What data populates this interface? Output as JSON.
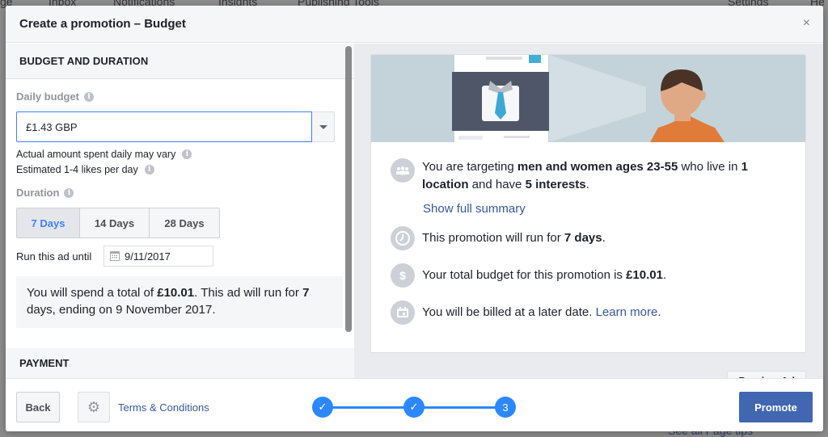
{
  "background": {
    "nav_items": [
      "ge",
      "Inbox",
      "Notifications",
      "Insights",
      "Publishing Tools",
      "Settings",
      "He"
    ],
    "bottom_tips": "See all Page tips"
  },
  "modal": {
    "title": "Create a promotion – Budget",
    "close_icon": "×"
  },
  "left": {
    "section_header": "BUDGET AND DURATION",
    "daily_budget_label": "Daily budget",
    "daily_budget_value": "£1.43 GBP",
    "hint_spend": "Actual amount spent daily may vary",
    "hint_likes": "Estimated 1-4 likes per day",
    "duration_label": "Duration",
    "duration_options": [
      {
        "label": "7 Days",
        "selected": true
      },
      {
        "label": "14 Days",
        "selected": false
      },
      {
        "label": "28 Days",
        "selected": false
      }
    ],
    "run_until_label": "Run this ad until",
    "run_until_date": "9/11/2017",
    "summary": {
      "pre": "You will spend a total of ",
      "total": "£10.01",
      "mid": ". This ad will run for ",
      "days": "7",
      "post": " days, ending on 9 November 2017."
    },
    "payment_header": "PAYMENT"
  },
  "right": {
    "targeting": {
      "pre": "You are targeting ",
      "audience": "men and women ages 23-55",
      "mid": " who live in ",
      "locations": "1 location",
      "mid2": " and have ",
      "interests": "5 interests",
      "post": "."
    },
    "show_full_summary": "Show full summary",
    "duration": {
      "pre": "This promotion will run for ",
      "value": "7 days",
      "post": "."
    },
    "budget": {
      "pre": "Your total budget for this promotion is ",
      "value": "£10.01",
      "post": "."
    },
    "billing": {
      "pre": "You will be billed at a later date. ",
      "link": "Learn more",
      "post": "."
    },
    "preview_ad": "Preview Ad"
  },
  "footer": {
    "back": "Back",
    "terms": "Terms & Conditions",
    "steps": [
      {
        "label": "✓",
        "status": "complete"
      },
      {
        "label": "✓",
        "status": "complete"
      },
      {
        "label": "3",
        "status": "current"
      }
    ],
    "promote": "Promote"
  },
  "colors": {
    "accent_blue": "#4267b2",
    "link_blue": "#365899",
    "step_blue": "#2d88ff",
    "selected_tab": "#4080ff"
  }
}
